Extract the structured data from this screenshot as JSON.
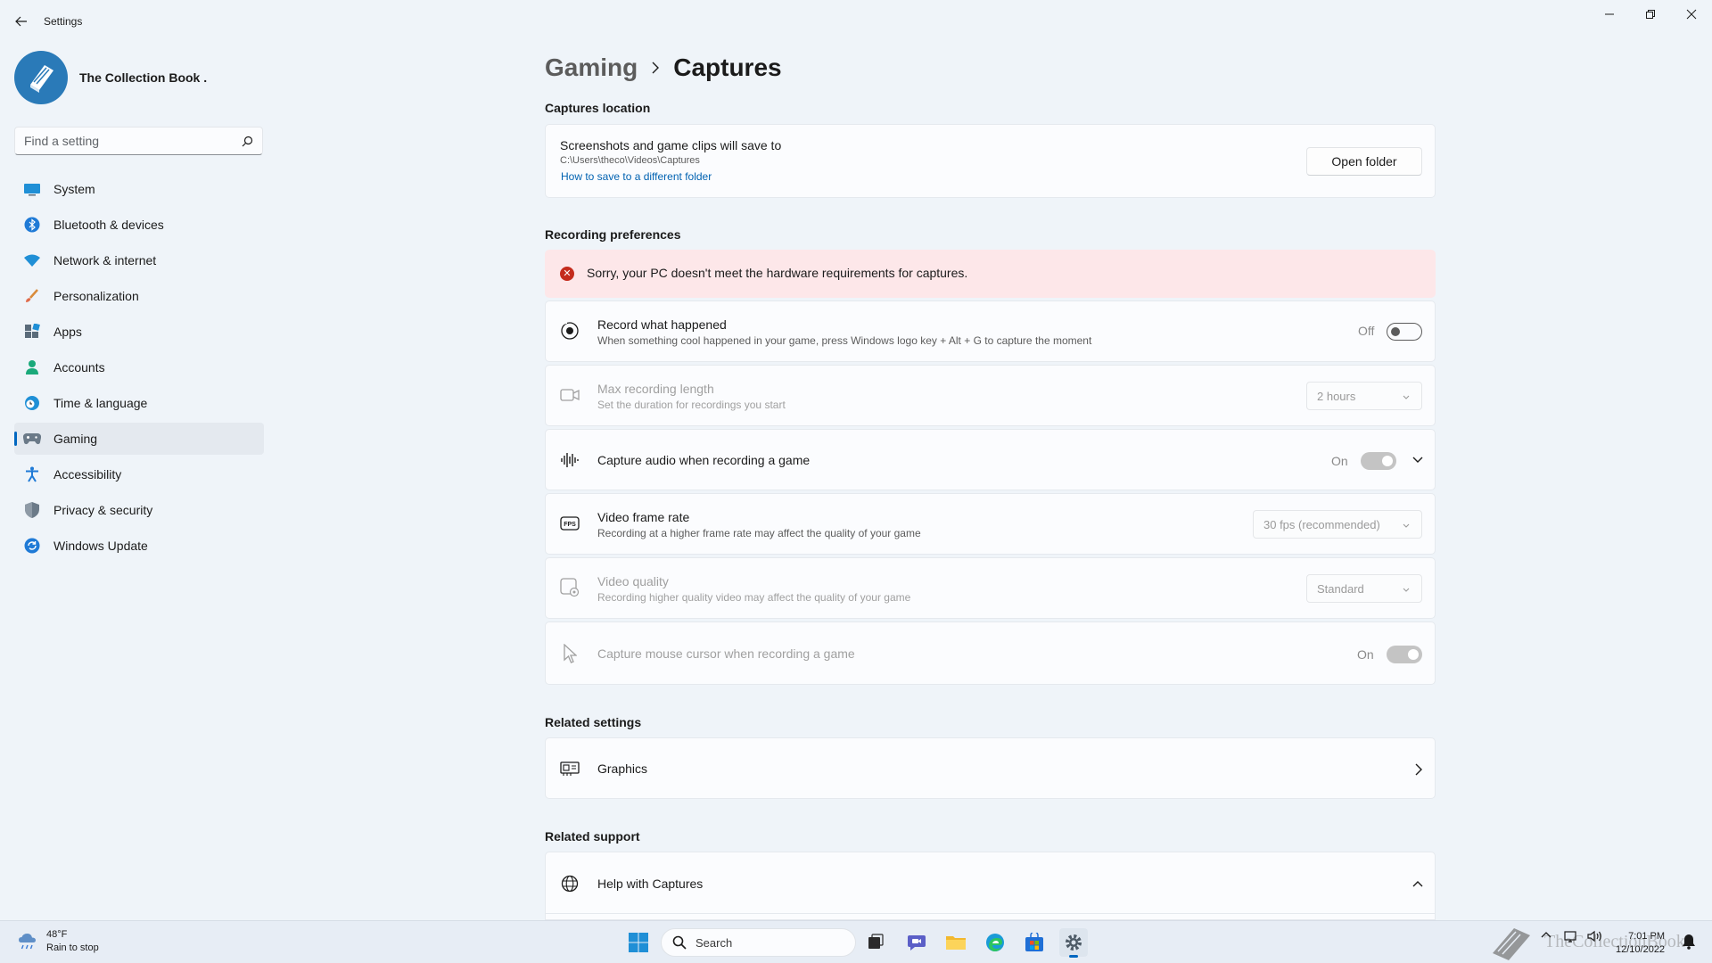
{
  "window": {
    "app_title": "Settings"
  },
  "profile": {
    "name": "The Collection Book ."
  },
  "search": {
    "placeholder": "Find a setting"
  },
  "nav": {
    "items": [
      {
        "label": "System",
        "icon": "monitor-icon"
      },
      {
        "label": "Bluetooth & devices",
        "icon": "bluetooth-icon"
      },
      {
        "label": "Network & internet",
        "icon": "wifi-icon"
      },
      {
        "label": "Personalization",
        "icon": "brush-icon"
      },
      {
        "label": "Apps",
        "icon": "apps-icon"
      },
      {
        "label": "Accounts",
        "icon": "person-icon"
      },
      {
        "label": "Time & language",
        "icon": "globe-clock-icon"
      },
      {
        "label": "Gaming",
        "icon": "controller-icon"
      },
      {
        "label": "Accessibility",
        "icon": "accessibility-icon"
      },
      {
        "label": "Privacy & security",
        "icon": "shield-icon"
      },
      {
        "label": "Windows Update",
        "icon": "update-icon"
      }
    ],
    "active": "Gaming"
  },
  "breadcrumb": {
    "parent": "Gaming",
    "current": "Captures"
  },
  "captures_location": {
    "heading": "Captures location",
    "title": "Screenshots and game clips will save to",
    "path": "C:\\Users\\theco\\Videos\\Captures",
    "link": "How to save to a different folder",
    "button": "Open folder"
  },
  "recording_preferences": {
    "heading": "Recording preferences",
    "error": "Sorry, your PC doesn't meet the hardware requirements for captures.",
    "record_what_happened": {
      "title": "Record what happened",
      "desc": "When something cool happened in your game, press Windows logo key + Alt + G to capture the moment",
      "state": "Off"
    },
    "max_recording_length": {
      "title": "Max recording length",
      "desc": "Set the duration for recordings you start",
      "value": "2 hours"
    },
    "capture_audio": {
      "title": "Capture audio when recording a game",
      "state": "On"
    },
    "video_frame_rate": {
      "title": "Video frame rate",
      "desc": "Recording at a higher frame rate may affect the quality of your game",
      "value": "30 fps (recommended)"
    },
    "video_quality": {
      "title": "Video quality",
      "desc": "Recording higher quality video may affect the quality of your game",
      "value": "Standard"
    },
    "capture_mouse": {
      "title": "Capture mouse cursor when recording a game",
      "state": "On"
    }
  },
  "related_settings": {
    "heading": "Related settings",
    "graphics": "Graphics"
  },
  "related_support": {
    "heading": "Related support",
    "help": "Help with Captures"
  },
  "taskbar": {
    "weather_temp": "48°F",
    "weather_desc": "Rain to stop",
    "search_label": "Search",
    "time": "7:01 PM",
    "date": "12/10/2022",
    "watermark": "TheCollectionBook"
  }
}
